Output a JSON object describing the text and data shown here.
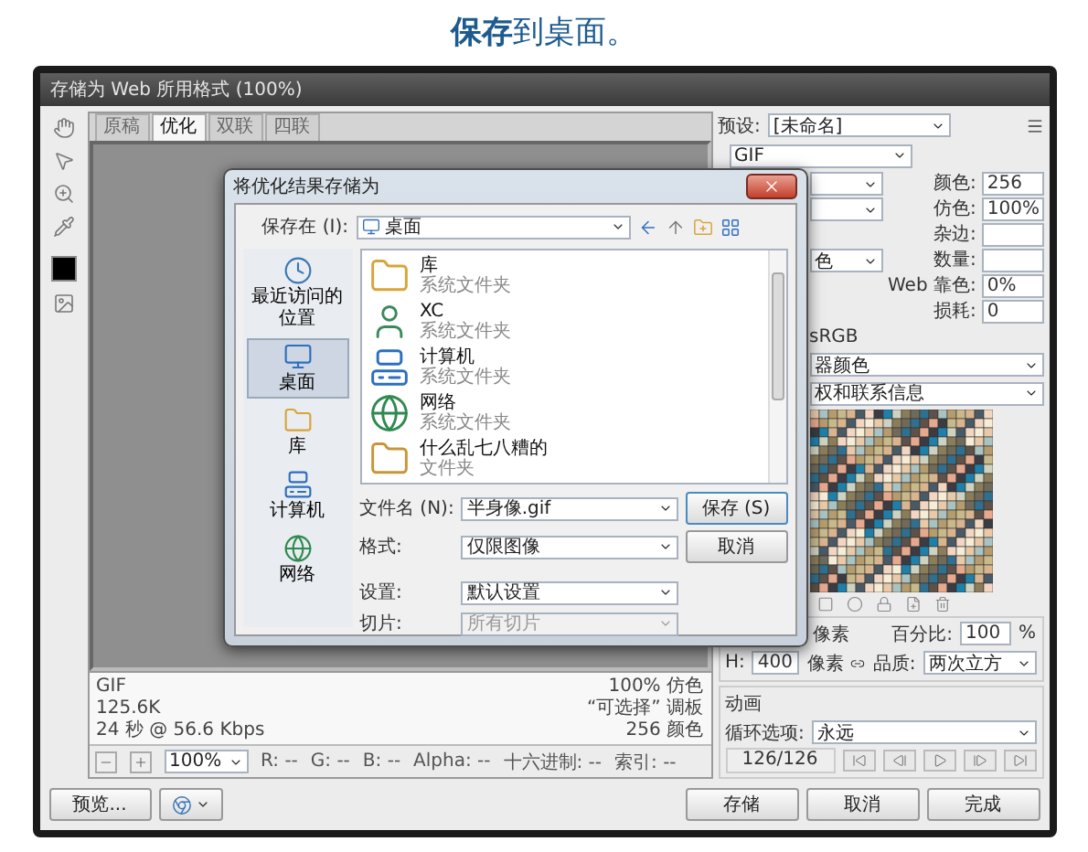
{
  "heading": "**保存**到桌面。",
  "window": {
    "title": "存储为 Web 所用格式 (100%)"
  },
  "view_tabs": [
    {
      "label": "原稿",
      "selected": false
    },
    {
      "label": "优化",
      "selected": true
    },
    {
      "label": "双联",
      "selected": false
    },
    {
      "label": "四联",
      "selected": false
    }
  ],
  "info_left": [
    "GIF",
    "125.6K",
    "24 秒 @ 56.6 Kbps"
  ],
  "info_right": [
    "100% 仿色",
    "“可选择” 调板",
    "256 颜色"
  ],
  "status": {
    "zoom": "100%",
    "readouts": [
      "R: --",
      "G: --",
      "B: --",
      "Alpha: --",
      "十六进制: --",
      "索引: --"
    ]
  },
  "preview_button": "预览...",
  "settings": {
    "preset_label": "预设:",
    "preset": "[未命名]",
    "format": "GIF",
    "rows": [
      {
        "kind": "dropdown",
        "label": "颜色:",
        "value": "256"
      },
      {
        "kind": "dropdown",
        "label": "仿色:",
        "value": "100%"
      },
      {
        "kind": "plain",
        "label": "杂边:"
      },
      {
        "kind": "dropdown",
        "dropdown_text": "色",
        "label": "数量:"
      },
      {
        "kind": "plain",
        "label": "Web 靠色:",
        "value": "0%"
      },
      {
        "kind": "plain",
        "label": "损耗:",
        "value": "0"
      }
    ],
    "color_label": "sRGB",
    "preview_color": "器颜色",
    "metadata": "权和联系信息"
  },
  "size": {
    "w_unit": "像素",
    "percent_label": "百分比:",
    "percent": "100",
    "percent_unit": "%",
    "h_label": "H:",
    "h": "400",
    "h_unit": "像素",
    "quality_label": "品质:",
    "quality": "两次立方"
  },
  "animation": {
    "title": "动画",
    "loop_label": "循环选项:",
    "loop": "永远",
    "frame": "126/126"
  },
  "buttons": [
    "存储",
    "取消",
    "完成"
  ],
  "dialog": {
    "title": "将优化结果存储为",
    "save_in_label": "保存在 (I):",
    "location": "桌面",
    "places": [
      {
        "label": "最近访问的位置",
        "selected": false
      },
      {
        "label": "桌面",
        "selected": true
      },
      {
        "label": "库",
        "selected": false
      },
      {
        "label": "计算机",
        "selected": false
      },
      {
        "label": "网络",
        "selected": false
      }
    ],
    "files": [
      {
        "name": "库",
        "type": "系统文件夹"
      },
      {
        "name": "XC",
        "type": "系统文件夹"
      },
      {
        "name": "计算机",
        "type": "系统文件夹"
      },
      {
        "name": "网络",
        "type": "系统文件夹"
      },
      {
        "name": "什么乱七八糟的",
        "type": "文件夹"
      }
    ],
    "filename_label": "文件名 (N):",
    "filename": "半身像.gif",
    "format_label": "格式:",
    "format": "仅限图像",
    "save": "保存 (S)",
    "cancel": "取消",
    "settings_label": "设置:",
    "settings": "默认设置",
    "slices_label": "切片:",
    "slices": "所有切片",
    "slices_disabled": true
  }
}
